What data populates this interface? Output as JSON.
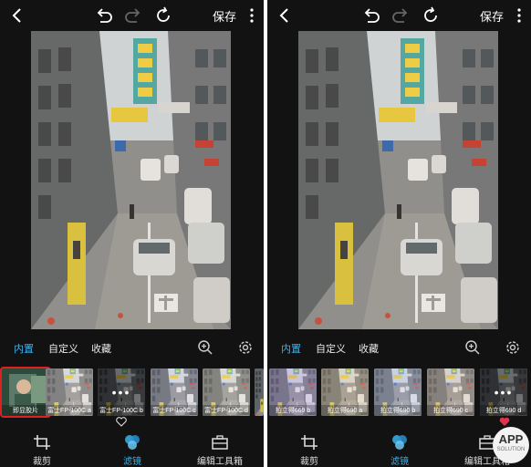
{
  "toolbar": {
    "save_label": "保存",
    "icons": [
      "back-arrow-icon",
      "undo-icon",
      "redo-icon",
      "reset-icon",
      "more-icon"
    ]
  },
  "tabs": {
    "builtin": "内置",
    "custom": "自定义",
    "favorites": "收藏"
  },
  "left_panel": {
    "thumbnails": [
      "即显胶片",
      "富士FP-100C a",
      "富士FP-100C b",
      "富士FP-100C c",
      "富士FP-100C d"
    ],
    "selected_index": 0,
    "favorited_index": 2
  },
  "right_panel": {
    "thumbnails": [
      "拍立得669 b",
      "拍立得690 a",
      "拍立得690 b",
      "拍立得690 c",
      "拍立得690 d"
    ],
    "favorited_index": 4
  },
  "bottom_nav": {
    "crop": "裁剪",
    "filter": "滤镜",
    "toolbox": "编辑工具箱",
    "active": "filter"
  },
  "watermark": {
    "line1": "APP",
    "line2": "SOLUTION"
  },
  "colors": {
    "accent": "#3bb3ee",
    "selected_border": "#e02020",
    "heart": "#e0334a",
    "background": "#121212"
  }
}
